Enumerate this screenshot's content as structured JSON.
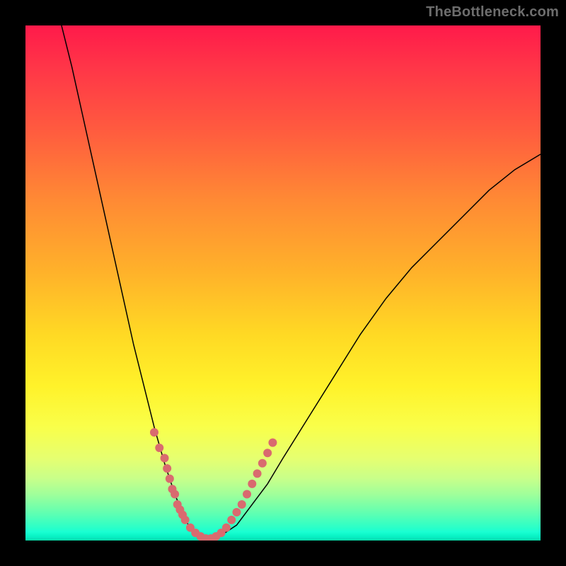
{
  "watermark": {
    "text": "TheBottleneck.com"
  },
  "chart_data": {
    "type": "line",
    "title": "",
    "xlabel": "",
    "ylabel": "",
    "xlim": [
      0,
      100
    ],
    "ylim": [
      0,
      100
    ],
    "grid": false,
    "legend": false,
    "gradient_stops": [
      {
        "pct": 0,
        "color": "#ff1a4a"
      },
      {
        "pct": 8,
        "color": "#ff3548"
      },
      {
        "pct": 20,
        "color": "#ff5a3f"
      },
      {
        "pct": 34,
        "color": "#ff8a34"
      },
      {
        "pct": 48,
        "color": "#ffb22a"
      },
      {
        "pct": 60,
        "color": "#ffd924"
      },
      {
        "pct": 70,
        "color": "#fff22a"
      },
      {
        "pct": 78,
        "color": "#f9ff4a"
      },
      {
        "pct": 84,
        "color": "#e6ff70"
      },
      {
        "pct": 88,
        "color": "#c8ff8a"
      },
      {
        "pct": 91,
        "color": "#a0ff9a"
      },
      {
        "pct": 93,
        "color": "#7dffa6"
      },
      {
        "pct": 95,
        "color": "#5affb4"
      },
      {
        "pct": 96.5,
        "color": "#3dffc0"
      },
      {
        "pct": 97.5,
        "color": "#2affc8"
      },
      {
        "pct": 98.3,
        "color": "#1affd2"
      },
      {
        "pct": 99.0,
        "color": "#0bf6c8"
      },
      {
        "pct": 100,
        "color": "#07d9a4"
      }
    ],
    "series": [
      {
        "name": "left-branch",
        "stroke_width": 1.5,
        "color": "#000000",
        "xy": [
          [
            7,
            100
          ],
          [
            9,
            92
          ],
          [
            11,
            83
          ],
          [
            13,
            74
          ],
          [
            15,
            65
          ],
          [
            17,
            56
          ],
          [
            19,
            47
          ],
          [
            21,
            38
          ],
          [
            23,
            30
          ],
          [
            25,
            22
          ],
          [
            27,
            15
          ],
          [
            29,
            9
          ],
          [
            31,
            4
          ],
          [
            33,
            1
          ],
          [
            35,
            0
          ]
        ]
      },
      {
        "name": "right-branch",
        "stroke_width": 1.5,
        "color": "#000000",
        "xy": [
          [
            35,
            0
          ],
          [
            38,
            1
          ],
          [
            41,
            3
          ],
          [
            44,
            7
          ],
          [
            47,
            11
          ],
          [
            50,
            16
          ],
          [
            55,
            24
          ],
          [
            60,
            32
          ],
          [
            65,
            40
          ],
          [
            70,
            47
          ],
          [
            75,
            53
          ],
          [
            80,
            58
          ],
          [
            85,
            63
          ],
          [
            90,
            68
          ],
          [
            95,
            72
          ],
          [
            100,
            75
          ]
        ]
      }
    ],
    "markers": {
      "type": "scatter",
      "color": "#d96a6f",
      "radius": 6,
      "xy": [
        [
          25,
          21
        ],
        [
          26,
          18
        ],
        [
          27,
          16
        ],
        [
          27.5,
          14
        ],
        [
          28,
          12
        ],
        [
          28.5,
          10
        ],
        [
          29,
          9
        ],
        [
          29.5,
          7
        ],
        [
          30,
          6
        ],
        [
          30.5,
          5
        ],
        [
          31,
          4
        ],
        [
          32,
          2.5
        ],
        [
          33,
          1.5
        ],
        [
          34,
          0.8
        ],
        [
          35,
          0.4
        ],
        [
          36,
          0.4
        ],
        [
          37,
          0.8
        ],
        [
          38,
          1.5
        ],
        [
          39,
          2.5
        ],
        [
          40,
          4
        ],
        [
          41,
          5.5
        ],
        [
          42,
          7
        ],
        [
          43,
          9
        ],
        [
          44,
          11
        ],
        [
          45,
          13
        ],
        [
          46,
          15
        ],
        [
          47,
          17
        ],
        [
          48,
          19
        ]
      ]
    }
  }
}
